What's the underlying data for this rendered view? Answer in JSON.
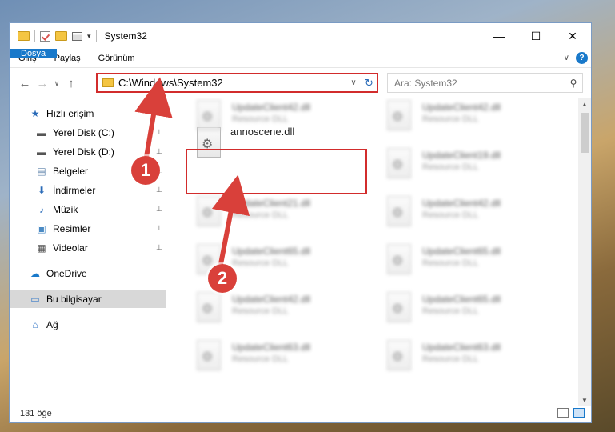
{
  "window": {
    "title": "System32",
    "controls": {
      "minimize": "—",
      "maximize": "☐",
      "close": "✕"
    }
  },
  "ribbon": {
    "tabs": [
      "Dosya",
      "Giriş",
      "Paylaş",
      "Görünüm"
    ],
    "help": "?",
    "expand": "∨"
  },
  "nav": {
    "back": "←",
    "forward": "→",
    "recent": "∨",
    "up": "↑",
    "address": "C:\\Windows\\System32",
    "address_drop": "∨",
    "refresh": "↻",
    "search_placeholder": "Ara: System32",
    "search_icon": "search-icon"
  },
  "sidebar": {
    "items": [
      {
        "label": "Hızlı erişim",
        "icon": "star-icon",
        "glyph": "★",
        "color": "#2a6bb8"
      },
      {
        "label": "Yerel Disk (C:)",
        "icon": "drive-icon",
        "glyph": "▬",
        "color": "#555555"
      },
      {
        "label": "Yerel Disk (D:)",
        "icon": "drive-icon",
        "glyph": "▬",
        "color": "#555555"
      },
      {
        "label": "Belgeler",
        "icon": "documents-icon",
        "glyph": "▤",
        "color": "#5a7fa8"
      },
      {
        "label": "İndirmeler",
        "icon": "downloads-icon",
        "glyph": "⬇",
        "color": "#2a6bb8"
      },
      {
        "label": "Müzik",
        "icon": "music-icon",
        "glyph": "♪",
        "color": "#2a6bb8"
      },
      {
        "label": "Resimler",
        "icon": "pictures-icon",
        "glyph": "▣",
        "color": "#4a8ac4"
      },
      {
        "label": "Videolar",
        "icon": "videos-icon",
        "glyph": "▦",
        "color": "#555555"
      },
      {
        "label": "OneDrive",
        "icon": "onedrive-icon",
        "glyph": "☁",
        "color": "#1979ca"
      },
      {
        "label": "Bu bilgisayar",
        "icon": "computer-icon",
        "glyph": "▭",
        "color": "#3a7bc8"
      },
      {
        "label": "Ağ",
        "icon": "network-icon",
        "glyph": "⌂",
        "color": "#3a7bc8"
      }
    ],
    "pin_glyph": "📌"
  },
  "files": {
    "highlighted": {
      "name": "annoscene.dll"
    },
    "blurred": [
      {
        "name": "UpdateClient42.dll",
        "type": "Resource DLL"
      },
      {
        "name": "UpdateClient42.dll",
        "type": "Resource DLL"
      },
      {
        "name": "UpdateClient19.dll",
        "type": "Resource DLL"
      },
      {
        "name": "UpdateClient21.dll",
        "type": "Resource DLL"
      },
      {
        "name": "UpdateClient42.dll",
        "type": "Resource DLL"
      },
      {
        "name": "UpdateClient65.dll",
        "type": "Resource DLL"
      },
      {
        "name": "UpdateClient65.dll",
        "type": "Resource DLL"
      },
      {
        "name": "UpdateClient42.dll",
        "type": "Resource DLL"
      },
      {
        "name": "UpdateClient65.dll",
        "type": "Resource DLL"
      },
      {
        "name": "UpdateClient63.dll",
        "type": "Resource DLL"
      },
      {
        "name": "UpdateClient63.dll",
        "type": "Resource DLL"
      }
    ]
  },
  "status": {
    "count": "131 öğe"
  },
  "callouts": {
    "one": "1",
    "two": "2"
  },
  "colors": {
    "accent": "#1979ca",
    "highlight": "#d22c2c",
    "callout": "#d9403a"
  }
}
